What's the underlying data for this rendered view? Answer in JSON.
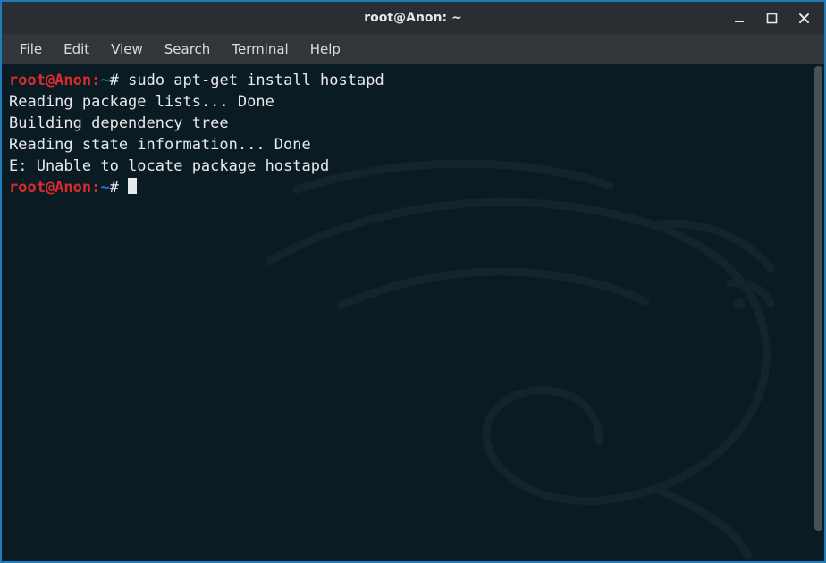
{
  "window": {
    "title": "root@Anon: ~"
  },
  "menu": {
    "items": [
      "File",
      "Edit",
      "View",
      "Search",
      "Terminal",
      "Help"
    ]
  },
  "prompt": {
    "user_host": "root@Anon",
    "path": "~",
    "symbol": "#"
  },
  "terminal": {
    "command1": "sudo apt-get install hostapd",
    "lines": [
      "Reading package lists... Done",
      "Building dependency tree",
      "Reading state information... Done",
      "E: Unable to locate package hostapd"
    ]
  },
  "colors": {
    "window_border": "#1e7db8",
    "titlebar_bg": "#2a2e33",
    "menubar_bg": "#31363b",
    "terminal_bg": "#0a1b24",
    "prompt_user": "#d92b2b",
    "prompt_path": "#2d6fd4",
    "fg": "#e9e9e9"
  }
}
